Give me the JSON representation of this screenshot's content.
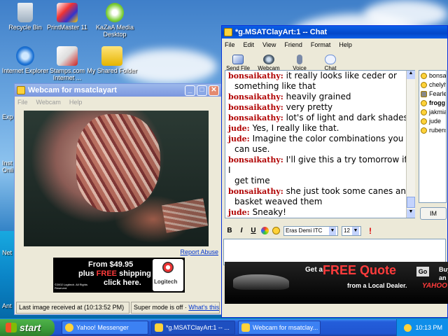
{
  "desktop": {
    "icons": [
      {
        "label": "Recycle Bin"
      },
      {
        "label": "PrintMaster 11"
      },
      {
        "label": "KaZaA Media Desktop"
      },
      {
        "label": "Internet Explorer"
      },
      {
        "label": "Stamps.com Internet ..."
      },
      {
        "label": "My Shared Folder"
      }
    ],
    "edge_labels": [
      "Exp",
      "Inst Onli",
      "Net",
      "Ant"
    ]
  },
  "webcam_window": {
    "title": "Webcam for msatclayart",
    "menu": [
      "File",
      "Webcam",
      "Help"
    ],
    "report_abuse": "Report Abuse",
    "ad": {
      "line1": "From $49.95",
      "line2a": "plus ",
      "line2b": "FREE",
      "line2c": " shipping",
      "line3": "click here.",
      "copyright": "©2002 Logitech. All Rights Reserved.",
      "brand": "Logitech"
    },
    "status": {
      "last_image": "Last image received at (10:13:52 PM)",
      "super_mode": "Super mode is off · ",
      "whats_this": "What's this?"
    }
  },
  "chat_window": {
    "title": "*g.MSATClayArt:1 -- Chat",
    "menu": [
      "File",
      "Edit",
      "View",
      "Friend",
      "Format",
      "Help"
    ],
    "tools": [
      {
        "label": "Send File",
        "icon": "send-file-icon"
      },
      {
        "label": "Webcam",
        "icon": "webcam-icon"
      },
      {
        "label": "Voice",
        "icon": "microphone-icon"
      },
      {
        "label": "Chat",
        "icon": "chat-bubbles-icon"
      }
    ],
    "messages": [
      {
        "who": "bonsaikathy:",
        "text": "it really looks like ceder or",
        "cont": "something like that"
      },
      {
        "who": "bonsaikathy:",
        "text": "heavily grained",
        "cont": ""
      },
      {
        "who": "bonsaikathy:",
        "text": "very pretty",
        "cont": ""
      },
      {
        "who": "bonsaikathy:",
        "text": "lot's of light and dark shades",
        "cont": ""
      },
      {
        "who": "jude:",
        "text": "Yes, I really like that.",
        "cont": ""
      },
      {
        "who": "jude:",
        "text": "Imagine the color combinations you",
        "cont": "can use."
      },
      {
        "who": "bonsaikathy:",
        "text": "I'll give this a try tomorrow if I",
        "cont": "get time"
      },
      {
        "who": "bonsaikathy:",
        "text": "she just took some canes and",
        "cont": "basket weaved them"
      },
      {
        "who": "jude:",
        "text": "Sneaky!",
        "cont": ""
      }
    ],
    "users": [
      "bonsa",
      "chelyh",
      "Fearle",
      "frogg",
      "jakmia",
      "jude",
      "rubens"
    ],
    "im_button": "IM",
    "format": {
      "bold": "B",
      "italic": "I",
      "underline": "U",
      "font": "Eras Demi ITC",
      "size": "12"
    },
    "ad": {
      "get_a": "Get a",
      "free_quote": "FREE Quote",
      "from_dealer": "from a Local Dealer.",
      "go": "Go",
      "buy": "Buy",
      "an": "an",
      "yahoo": "YAHOO"
    }
  },
  "taskbar": {
    "start": "start",
    "tasks": [
      {
        "label": "Yahoo! Messenger"
      },
      {
        "label": "*g.MSATClayArt:1 -- ..."
      },
      {
        "label": "Webcam for msatclay..."
      }
    ],
    "clock": "10:13 PM"
  },
  "colors": {
    "chat_name": "#b00000",
    "xp_title_active": "#0347c8",
    "taskbar": "#245edb",
    "start_green": "#3b9a38",
    "link_blue": "#0033cc"
  }
}
